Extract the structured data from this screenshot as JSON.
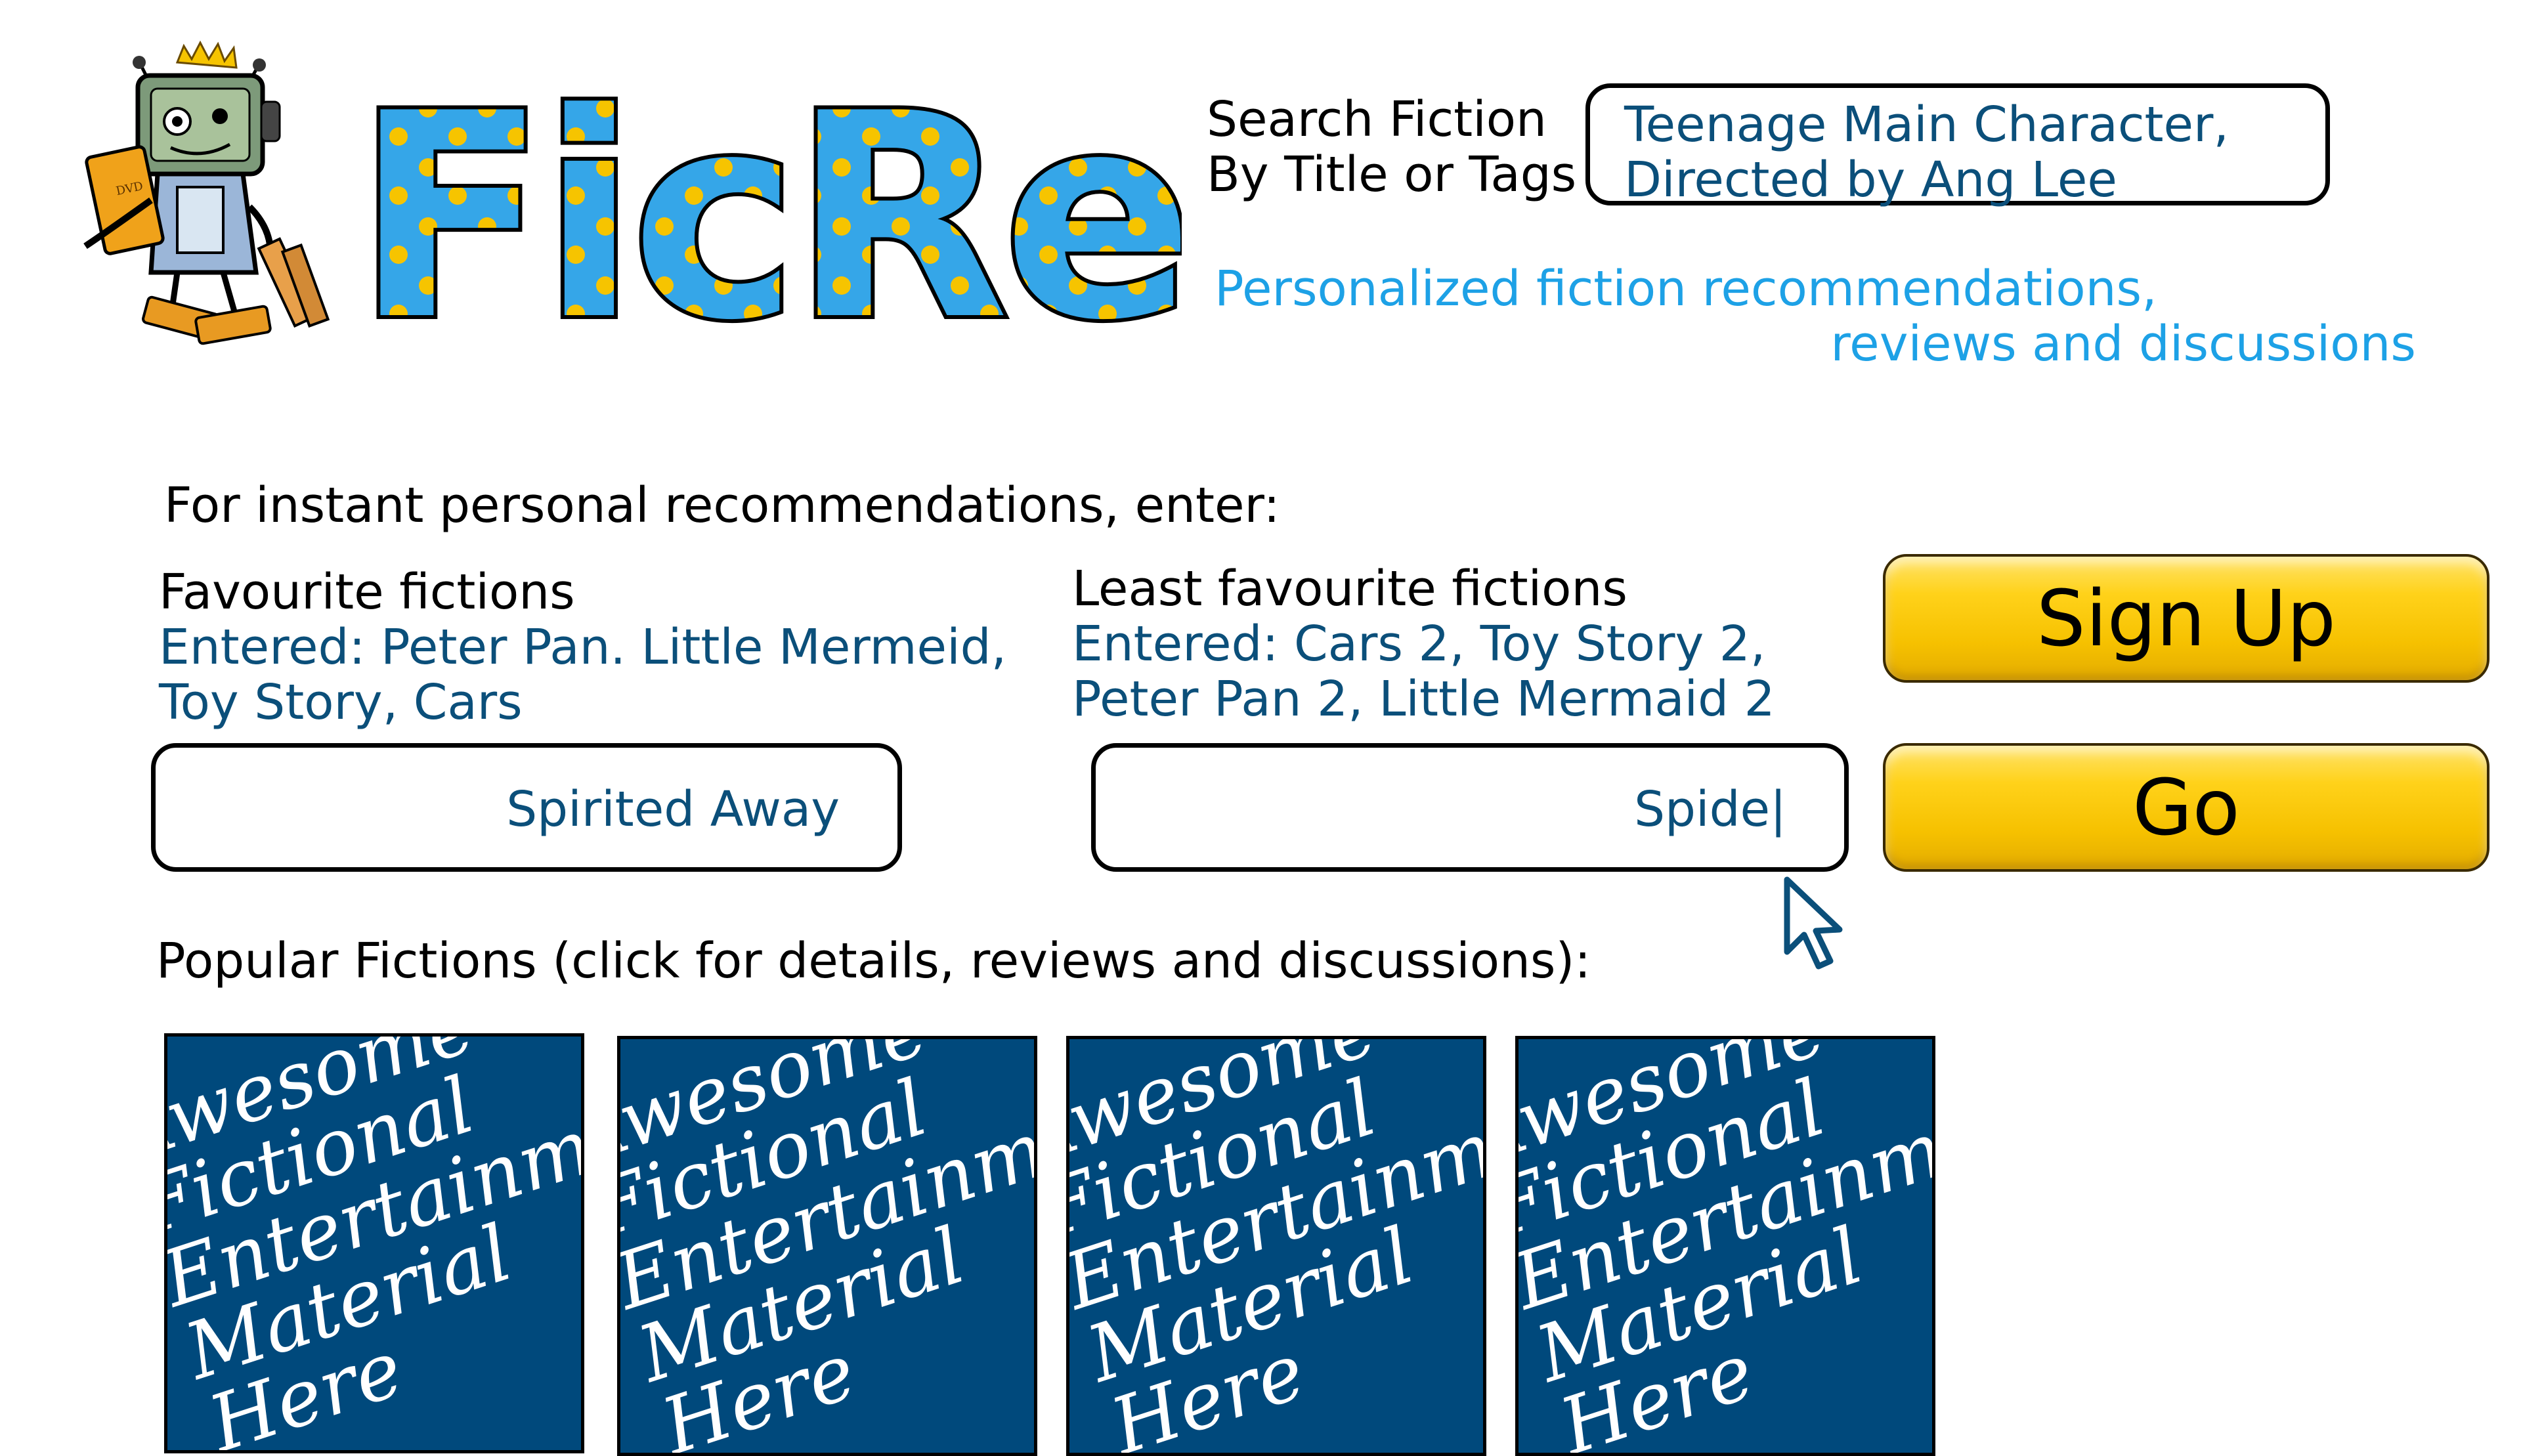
{
  "logo": {
    "wordmark": "FicRec"
  },
  "header": {
    "search_label": "Search Fiction\nBy Title or Tags",
    "search_value": "Teenage Main Character,\nDirected by Ang Lee",
    "tagline_line1": "Personalized fiction recommendations,",
    "tagline_line2": "reviews and discussions"
  },
  "recommend": {
    "intro": "For instant personal recommendations, enter:",
    "favourite": {
      "title": "Favourite fictions",
      "entered": "Entered: Peter Pan. Little Mermeid,\nToy Story, Cars",
      "input_value": "Spirited Away"
    },
    "least_favourite": {
      "title": "Least favourite fictions",
      "entered": "Entered: Cars 2, Toy Story 2,\nPeter Pan 2, Little Mermaid 2",
      "input_value": "Spide|"
    }
  },
  "buttons": {
    "signup_label": "Sign Up",
    "go_label": "Go"
  },
  "popular": {
    "heading": "Popular Fictions (click for details, reviews and discussions):",
    "cards": [
      {
        "text": "Awesome\nFictional\nEntertainment\nMaterial\nHere"
      },
      {
        "text": "Awesome\nFictional\nEntertainment\nMaterial\nHere"
      },
      {
        "text": "Awesome\nFictional\nEntertainment\nMaterial\nHere"
      },
      {
        "text": "Awesome\nFictional\nEntertainment\nMaterial\nHere"
      }
    ]
  },
  "colors": {
    "link_blue": "#0b4f7a",
    "tagline_blue": "#1da1e6",
    "button_yellow": "#ffd21a",
    "card_blue": "#00497c"
  }
}
